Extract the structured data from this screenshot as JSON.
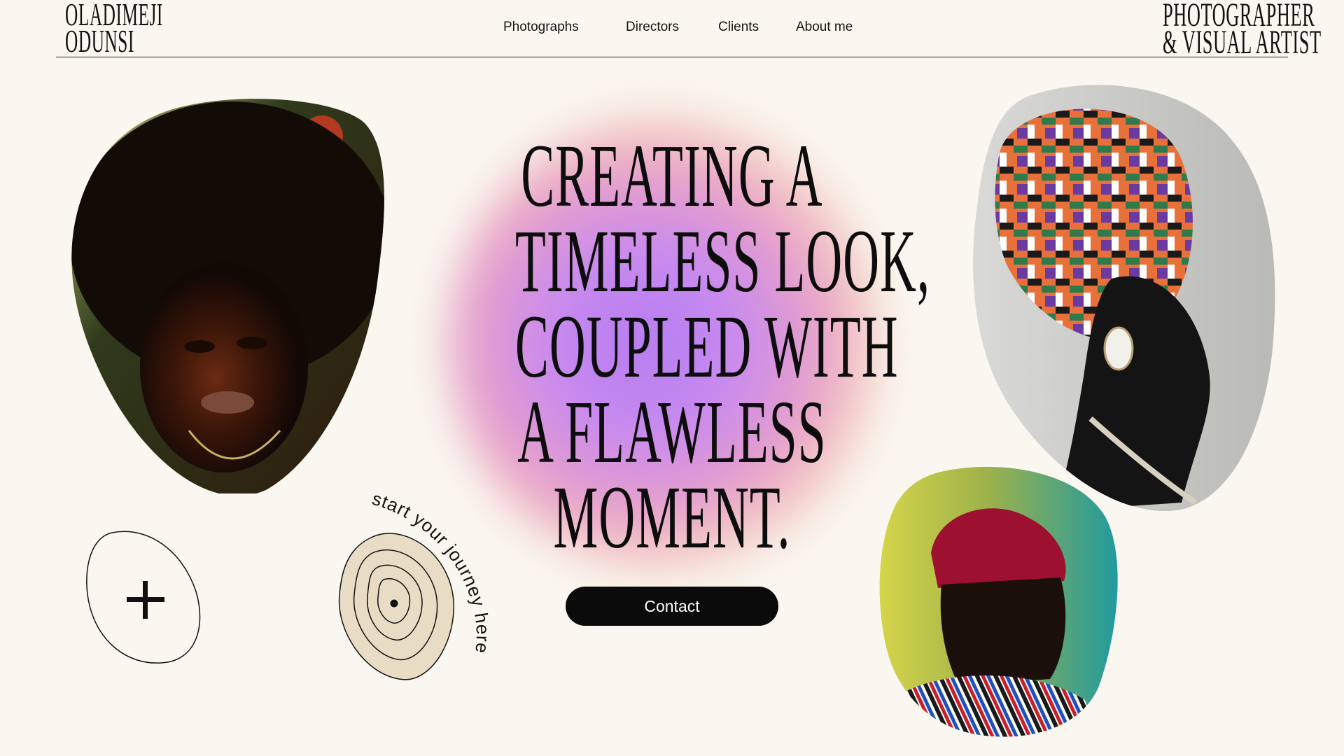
{
  "brand": {
    "line1": "OLADIMEJI",
    "line2": "ODUNSI"
  },
  "tagline": {
    "line1": "PHOTOGRAPHER",
    "line2": "& VISUAL ARTIST"
  },
  "nav": {
    "items": [
      {
        "label": "Photographs"
      },
      {
        "label": "Directors"
      },
      {
        "label": "Clients"
      },
      {
        "label": "About me"
      }
    ]
  },
  "hero": {
    "headline_lines": [
      "CREATING A",
      "TIMELESS LOOK,",
      "COUPLED WITH",
      "A FLAWLESS",
      "MOMENT."
    ],
    "contact_label": "Contact"
  },
  "journey": {
    "text": "start your journey here"
  },
  "colors": {
    "background": "#faf7f0",
    "text": "#111111",
    "button": "#0b0b0b",
    "glow_purple": "#b47cf0",
    "glow_pink": "#e7a0c8",
    "ring_fill": "#e8dcc4"
  },
  "icons": {
    "plus": "plus-icon"
  }
}
